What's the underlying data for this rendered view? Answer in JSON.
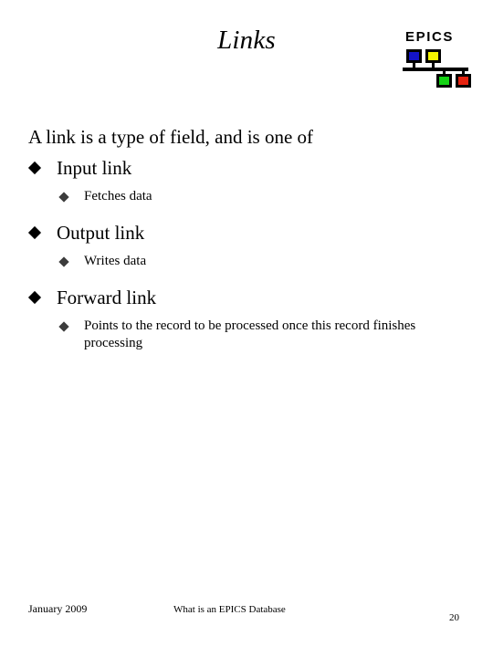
{
  "slide": {
    "title": "Links",
    "intro": "A link is a type of field, and is one of",
    "bullets": [
      {
        "label": "Input link",
        "sub": "Fetches data"
      },
      {
        "label": "Output link",
        "sub": "Writes data"
      },
      {
        "label": "Forward link",
        "sub": "Points to the record to be processed once this record finishes processing"
      }
    ]
  },
  "logo": {
    "wordmark": "EPICS",
    "colors": {
      "node_blue": "#1414c8",
      "node_yellow": "#f5f500",
      "node_green": "#14d214",
      "node_red": "#e62310",
      "bus": "#000000"
    }
  },
  "footer": {
    "date": "January 2009",
    "subject": "What is an EPICS Database",
    "page_number": "20"
  },
  "theme": {
    "background": "#ffffff",
    "text": "#000000",
    "bullet_l1": "#000000",
    "bullet_l2": "#3c3c3c"
  }
}
